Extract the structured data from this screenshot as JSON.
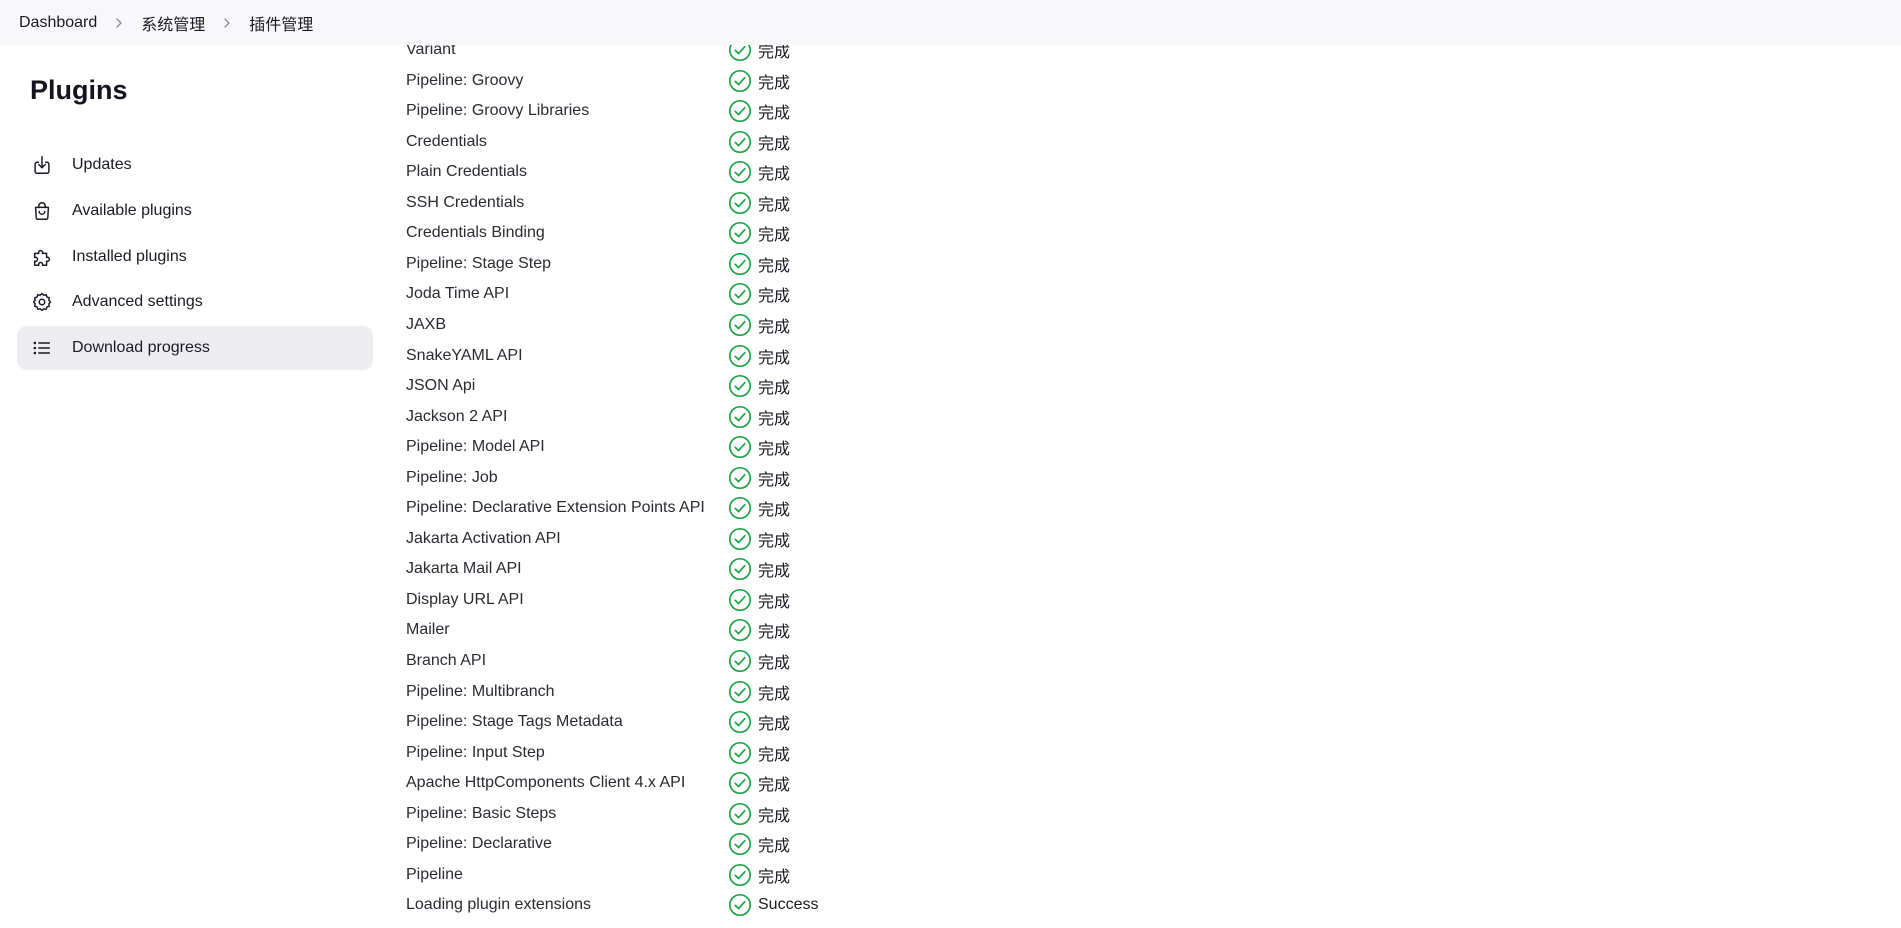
{
  "breadcrumb": {
    "items": [
      "Dashboard",
      "系统管理",
      "插件管理"
    ]
  },
  "sidebar": {
    "title": "Plugins",
    "items": [
      {
        "label": "Updates",
        "icon": "download-icon",
        "active": false
      },
      {
        "label": "Available plugins",
        "icon": "shopping-bag-icon",
        "active": false
      },
      {
        "label": "Installed plugins",
        "icon": "puzzle-piece-icon",
        "active": false
      },
      {
        "label": "Advanced settings",
        "icon": "gear-icon",
        "active": false
      },
      {
        "label": "Download progress",
        "icon": "list-icon",
        "active": true
      }
    ]
  },
  "progress": {
    "rows": [
      {
        "name": "Variant",
        "status": "完成"
      },
      {
        "name": "Pipeline: Groovy",
        "status": "完成"
      },
      {
        "name": "Pipeline: Groovy Libraries",
        "status": "完成"
      },
      {
        "name": "Credentials",
        "status": "完成"
      },
      {
        "name": "Plain Credentials",
        "status": "完成"
      },
      {
        "name": "SSH Credentials",
        "status": "完成"
      },
      {
        "name": "Credentials Binding",
        "status": "完成"
      },
      {
        "name": "Pipeline: Stage Step",
        "status": "完成"
      },
      {
        "name": "Joda Time API",
        "status": "完成"
      },
      {
        "name": "JAXB",
        "status": "完成"
      },
      {
        "name": "SnakeYAML API",
        "status": "完成"
      },
      {
        "name": "JSON Api",
        "status": "完成"
      },
      {
        "name": "Jackson 2 API",
        "status": "完成"
      },
      {
        "name": "Pipeline: Model API",
        "status": "完成"
      },
      {
        "name": "Pipeline: Job",
        "status": "完成"
      },
      {
        "name": "Pipeline: Declarative Extension Points API",
        "status": "完成"
      },
      {
        "name": "Jakarta Activation API",
        "status": "完成"
      },
      {
        "name": "Jakarta Mail API",
        "status": "完成"
      },
      {
        "name": "Display URL API",
        "status": "完成"
      },
      {
        "name": "Mailer",
        "status": "完成"
      },
      {
        "name": "Branch API",
        "status": "完成"
      },
      {
        "name": "Pipeline: Multibranch",
        "status": "完成"
      },
      {
        "name": "Pipeline: Stage Tags Metadata",
        "status": "完成"
      },
      {
        "name": "Pipeline: Input Step",
        "status": "完成"
      },
      {
        "name": "Apache HttpComponents Client 4.x API",
        "status": "完成"
      },
      {
        "name": "Pipeline: Basic Steps",
        "status": "完成"
      },
      {
        "name": "Pipeline: Declarative",
        "status": "完成"
      },
      {
        "name": "Pipeline",
        "status": "完成"
      },
      {
        "name": "Loading plugin extensions",
        "status": "Success"
      }
    ],
    "status_icon": "check-circle-icon",
    "success_color": "#1ea446"
  }
}
